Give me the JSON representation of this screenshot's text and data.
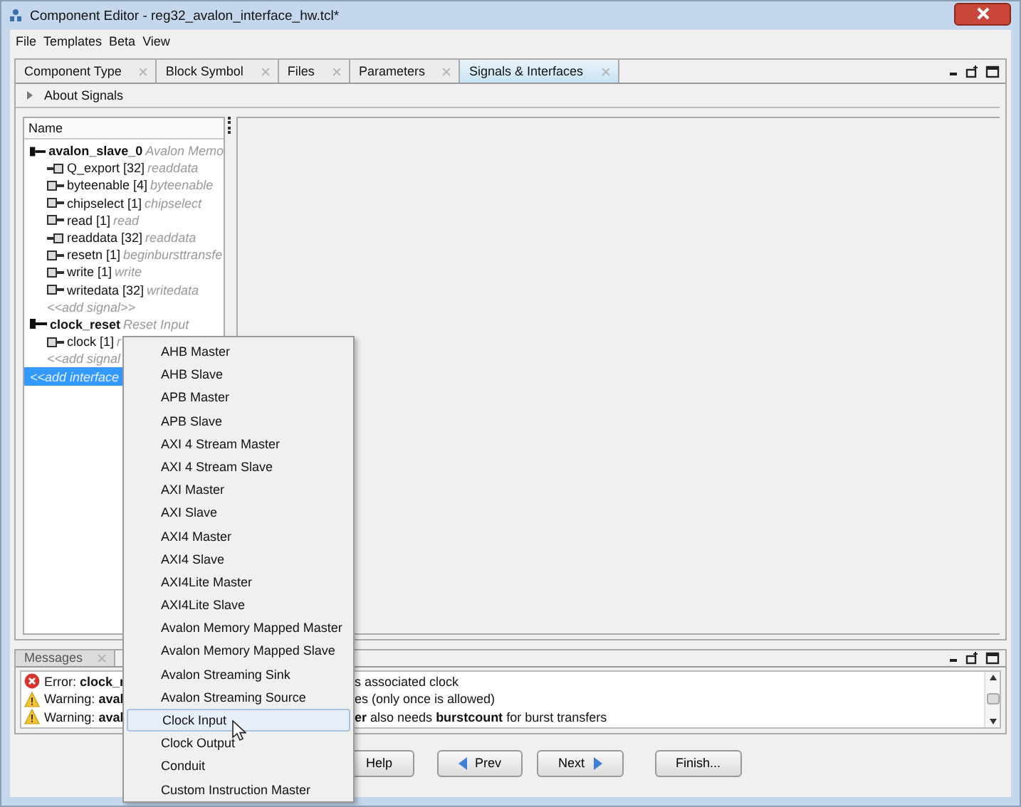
{
  "window": {
    "title": "Component Editor - reg32_avalon_interface_hw.tcl*"
  },
  "menubar": [
    "File",
    "Templates",
    "Beta",
    "View"
  ],
  "tabs": [
    {
      "label": "Component Type",
      "selected": false
    },
    {
      "label": "Block Symbol",
      "selected": false
    },
    {
      "label": "Files",
      "selected": false
    },
    {
      "label": "Parameters",
      "selected": false
    },
    {
      "label": "Signals & Interfaces",
      "selected": true
    }
  ],
  "about": {
    "label": "About Signals",
    "expanded": false
  },
  "tree": {
    "heading": "Name",
    "items": [
      {
        "kind": "interface",
        "name": "avalon_slave_0",
        "type": "Avalon Memo",
        "children": [
          {
            "kind": "output-signal",
            "name": "Q_export [32]",
            "type": "readdata"
          },
          {
            "kind": "input-signal",
            "name": "byteenable [4]",
            "type": "byteenable"
          },
          {
            "kind": "input-signal",
            "name": "chipselect [1]",
            "type": "chipselect"
          },
          {
            "kind": "input-signal",
            "name": "read [1]",
            "type": "read"
          },
          {
            "kind": "output-signal",
            "name": "readdata [32]",
            "type": "readdata"
          },
          {
            "kind": "input-signal",
            "name": "resetn [1]",
            "type": "beginbursttransfe"
          },
          {
            "kind": "input-signal",
            "name": "write [1]",
            "type": "write"
          },
          {
            "kind": "input-signal",
            "name": "writedata [32]",
            "type": "writedata"
          },
          {
            "kind": "add",
            "name": "<<add signal>>"
          }
        ]
      },
      {
        "kind": "interface",
        "name": "clock_reset",
        "type": "Reset Input",
        "children": [
          {
            "kind": "input-signal",
            "name": "clock [1]",
            "type": "r"
          },
          {
            "kind": "add",
            "name": "<<add signal"
          }
        ]
      },
      {
        "kind": "add",
        "name": "<<add interface",
        "selected": true
      }
    ]
  },
  "messages": {
    "title": "Messages",
    "items": [
      {
        "kind": "error",
        "prefix": "Error:",
        "left": "clock_r",
        "right": "s associated clock"
      },
      {
        "kind": "warning",
        "prefix": "Warning:",
        "left": "aval",
        "right": "es (only once is allowed)"
      },
      {
        "kind": "warning",
        "prefix": "Warning:",
        "left": "aval",
        "right": "**er** also needs **burstcount** for burst transfers"
      }
    ]
  },
  "buttons": [
    {
      "label": "Help",
      "kind": "plain"
    },
    {
      "label": "Prev",
      "kind": "back"
    },
    {
      "label": "Next",
      "kind": "forward"
    },
    {
      "label": "Finish...",
      "kind": "plain"
    }
  ],
  "context_menu": {
    "items": [
      {
        "label": "AHB Master",
        "selected": false
      },
      {
        "label": "AHB Slave",
        "selected": false
      },
      {
        "label": "APB Master",
        "selected": false
      },
      {
        "label": "APB Slave",
        "selected": false
      },
      {
        "label": "AXI 4 Stream Master",
        "selected": false
      },
      {
        "label": "AXI 4 Stream Slave",
        "selected": false
      },
      {
        "label": "AXI Master",
        "selected": false
      },
      {
        "label": "AXI Slave",
        "selected": false
      },
      {
        "label": "AXI4 Master",
        "selected": false
      },
      {
        "label": "AXI4 Slave",
        "selected": false
      },
      {
        "label": "AXI4Lite Master",
        "selected": false
      },
      {
        "label": "AXI4Lite Slave",
        "selected": false
      },
      {
        "label": "Avalon Memory Mapped Master",
        "selected": false
      },
      {
        "label": "Avalon Memory Mapped Slave",
        "selected": false
      },
      {
        "label": "Avalon Streaming Sink",
        "selected": false
      },
      {
        "label": "Avalon Streaming Source",
        "selected": false
      },
      {
        "label": "Clock Input",
        "selected": true
      },
      {
        "label": "Clock Output",
        "selected": false
      },
      {
        "label": "Conduit",
        "selected": false
      },
      {
        "label": "Custom Instruction Master",
        "selected": false
      }
    ]
  }
}
